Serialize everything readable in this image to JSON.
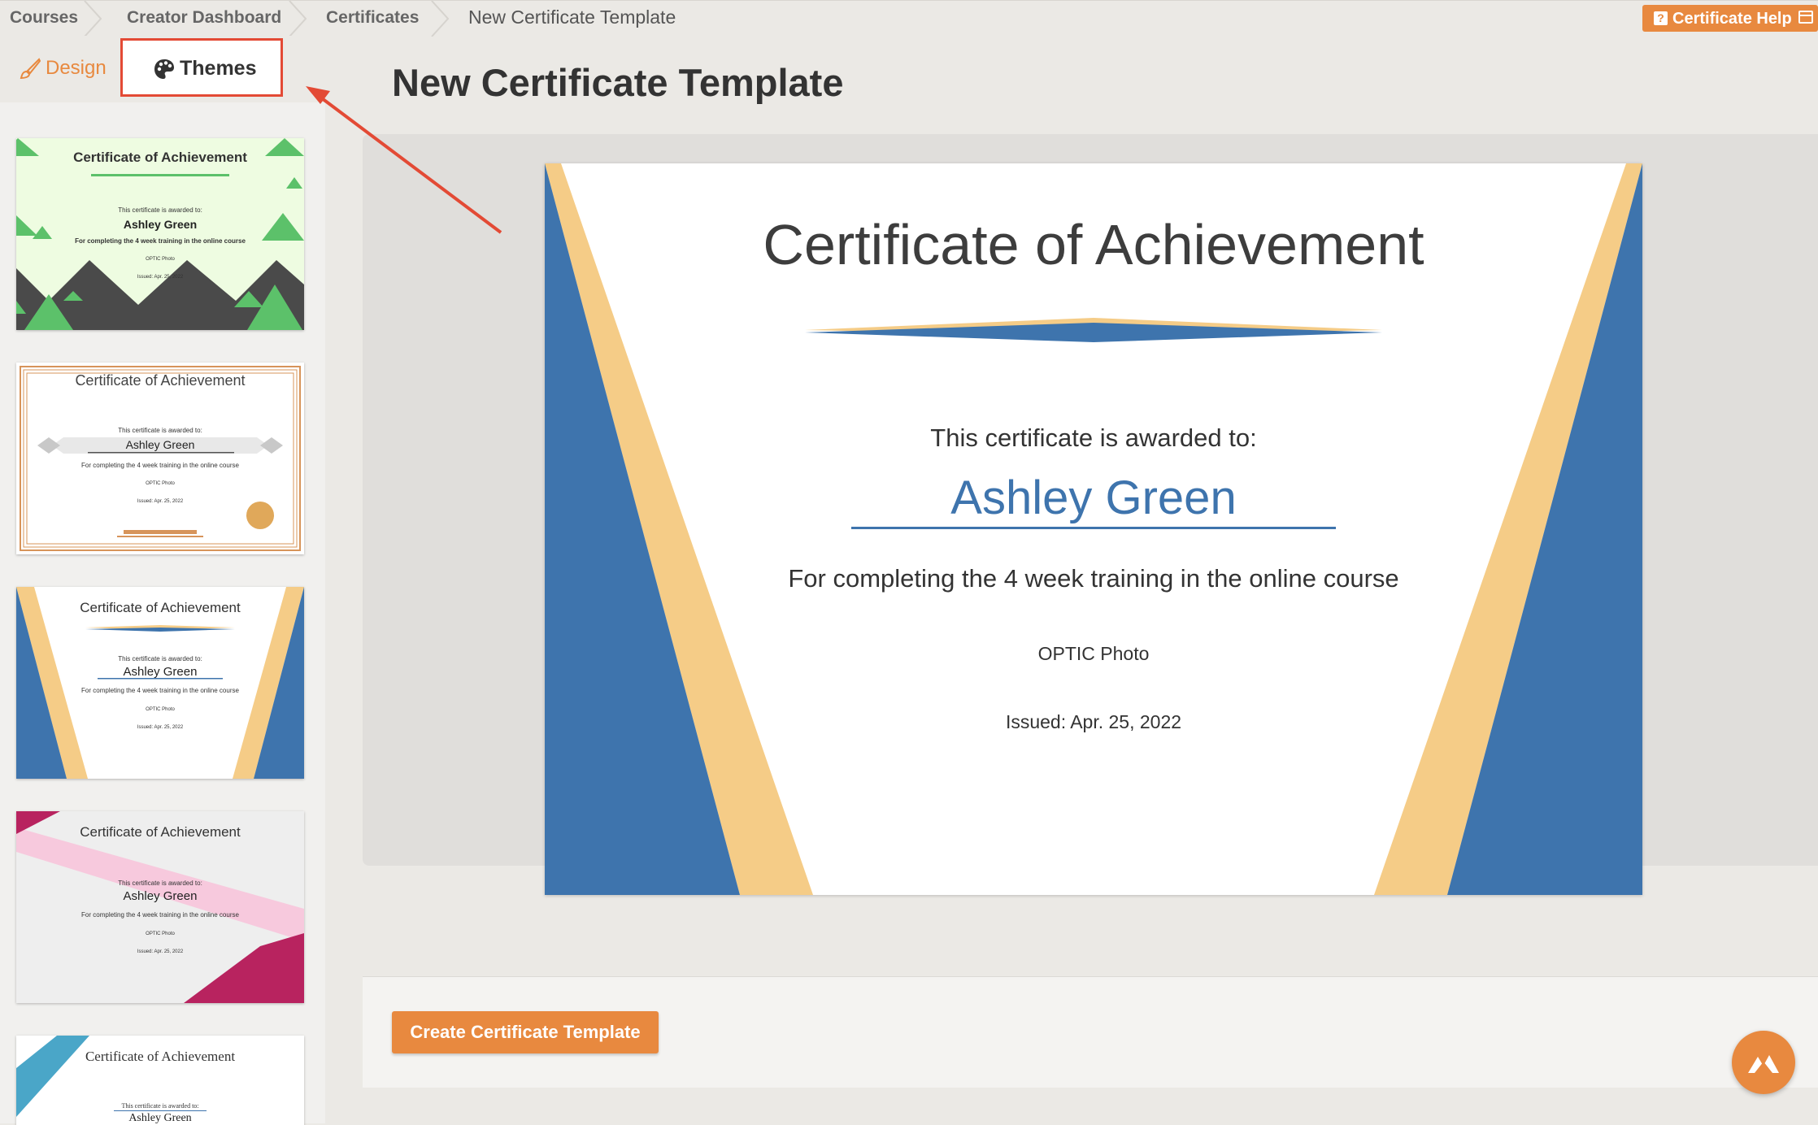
{
  "breadcrumb": {
    "items": [
      "Courses",
      "Creator Dashboard",
      "Certificates"
    ],
    "current": "New Certificate Template"
  },
  "help": {
    "label": "Certificate Help"
  },
  "sidebar": {
    "tabs": {
      "design": "Design",
      "themes": "Themes"
    },
    "thumbnails": [
      {
        "title": "Certificate of Achievement",
        "sub": "This certificate is awarded to:",
        "name": "Ashley Green",
        "desc": "For completing the 4 week training in the online course",
        "org": "OPTIC Photo",
        "date": "Issued: Apr. 25, 2022"
      },
      {
        "title": "Certificate of Achievement",
        "sub": "This certificate is awarded to:",
        "name": "Ashley Green",
        "desc": "For completing the 4 week training in the online course",
        "org": "OPTIC Photo",
        "date": "Issued: Apr. 25, 2022"
      },
      {
        "title": "Certificate of Achievement",
        "sub": "This certificate is awarded to:",
        "name": "Ashley Green",
        "desc": "For completing the 4 week training in the online course",
        "org": "OPTIC Photo",
        "date": "Issued: Apr. 25, 2022"
      },
      {
        "title": "Certificate of Achievement",
        "sub": "This certificate is awarded to:",
        "name": "Ashley Green",
        "desc": "For completing the 4 week training in the online course",
        "org": "OPTIC Photo",
        "date": "Issued: Apr. 25, 2022"
      },
      {
        "title": "Certificate of Achievement",
        "sub": "This certificate is awarded to:",
        "name": "Ashley Green"
      }
    ]
  },
  "main": {
    "title": "New Certificate Template",
    "certificate": {
      "title": "Certificate of Achievement",
      "subtitle": "This certificate is awarded to:",
      "recipient": "Ashley Green",
      "description": "For completing the 4 week training in the online course",
      "organization": "OPTIC Photo",
      "issued": "Issued: Apr. 25, 2022"
    },
    "create_button": "Create Certificate Template"
  },
  "colors": {
    "accent": "#e8893f",
    "highlight": "#e34a35",
    "cert_blue": "#3e74ad",
    "cert_gold": "#f5cc87"
  },
  "icons": [
    "brush-icon",
    "palette-icon",
    "help-icon",
    "window-icon",
    "chevron-separator-icon",
    "mountain-logo-icon"
  ]
}
